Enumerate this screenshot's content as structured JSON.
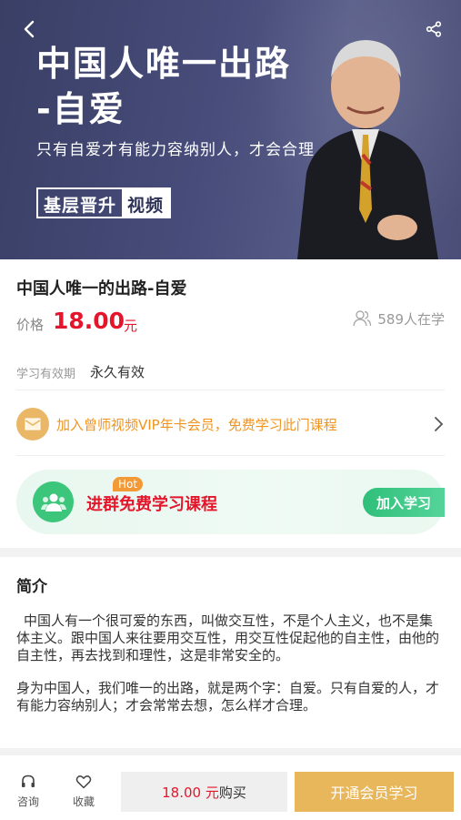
{
  "hero": {
    "title_line1": "中国人唯一出路",
    "title_line2": "-自爱",
    "subtitle": "只有自爱才有能力容纳别人，才会合理",
    "tag_left": "基层晋升",
    "tag_right": "视频",
    "icons": {
      "back": "back-arrow-icon",
      "share": "share-icon"
    },
    "bg_color": "#474c7a"
  },
  "course": {
    "title": "中国人唯一的出路-自爱",
    "price_label": "价格",
    "price": "18.00",
    "price_unit": "元",
    "learners": "589人在学",
    "validity_label": "学习有效期",
    "validity_value": "永久有效"
  },
  "vip_promo": {
    "text": "加入曾师视频VIP年卡会员，免费学习此门课程",
    "color": "#f0941e"
  },
  "group": {
    "hot": "Hot",
    "text": "进群免费学习课程",
    "button": "加入学习",
    "accent": "#3cc67b"
  },
  "intro": {
    "title": "简介",
    "paragraph1": "中国人有一个很可爱的东西，叫做交互性，不是个人主义，也不是集体主义。跟中国人来往要用交互性，用交互性促起他的自主性，由他的自主性，再去找到和理性，这是非常安全的。",
    "paragraph2": "身为中国人，我们唯一的出路，就是两个字：自爱。只有自爱的人，才有能力容纳别人；才会常常去想，怎么样才合理。"
  },
  "bottom_bar": {
    "consult": "咨询",
    "favorite": "收藏",
    "buy_price": "18.00 元",
    "buy_text": "购买",
    "vip_button": "开通会员学习",
    "price_color": "#e3162c",
    "vip_color": "#e8b65b"
  }
}
